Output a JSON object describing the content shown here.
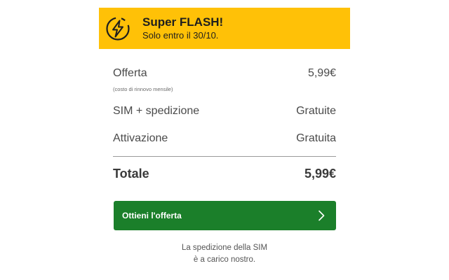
{
  "promo": {
    "icon": "lightning-bolt-icon",
    "title": "Super FLASH!",
    "subtitle": "Solo entro il 30/10.",
    "background_color": "#ffc107"
  },
  "summary": {
    "offer": {
      "label": "Offerta",
      "value": "5,99€",
      "note": "(costo di rinnovo mensile)"
    },
    "sim": {
      "label": "SIM + spedizione",
      "value": "Gratuite"
    },
    "activation": {
      "label": "Attivazione",
      "value": "Gratuita"
    },
    "total": {
      "label": "Totale",
      "value": "5,99€"
    }
  },
  "cta": {
    "label": "Ottieni l'offerta",
    "icon": "chevron-right-icon",
    "background_color": "#1b7f2a"
  },
  "shipping_note": {
    "line1": "La spedizione della SIM",
    "line2": "è a carico nostro."
  }
}
